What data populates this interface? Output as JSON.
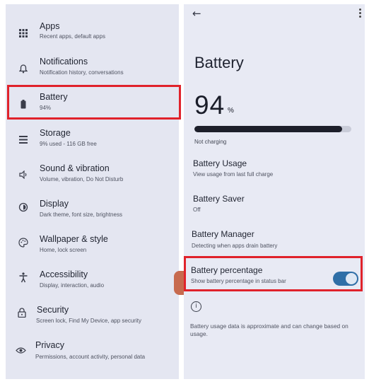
{
  "left": {
    "items": [
      {
        "icon": "apps-grid-icon",
        "glyph": "⋮⋮",
        "title": "Apps",
        "subtitle": "Recent apps, default apps"
      },
      {
        "icon": "bell-icon",
        "glyph": "🔔︎",
        "title": "Notifications",
        "subtitle": "Notification history, conversations"
      },
      {
        "icon": "battery-icon",
        "glyph": "▮",
        "title": "Battery",
        "subtitle": "94%"
      },
      {
        "icon": "storage-icon",
        "glyph": "☰",
        "title": "Storage",
        "subtitle": "9% used - 116 GB free"
      },
      {
        "icon": "speaker-icon",
        "glyph": "🔈︎",
        "title": "Sound & vibration",
        "subtitle": "Volume, vibration, Do Not Disturb"
      },
      {
        "icon": "display-icon",
        "glyph": "☼",
        "title": "Display",
        "subtitle": "Dark theme, font size, brightness"
      },
      {
        "icon": "palette-icon",
        "glyph": "🎨︎",
        "title": "Wallpaper & style",
        "subtitle": "Home, lock screen"
      },
      {
        "icon": "accessibility-icon",
        "glyph": "♿︎",
        "title": "Accessibility",
        "subtitle": "Display, interaction, audio"
      },
      {
        "icon": "lock-icon",
        "glyph": "🔒︎",
        "title": "Security",
        "subtitle": "Screen lock, Find My Device, app security"
      },
      {
        "icon": "privacy-eye-icon",
        "glyph": "◉",
        "title": "Privacy",
        "subtitle": "Permissions, account activity, personal data"
      }
    ]
  },
  "right": {
    "title": "Battery",
    "percent_value": "94",
    "percent_unit": "%",
    "level": 0.94,
    "charging_status": "Not charging",
    "options": [
      {
        "title": "Battery Usage",
        "subtitle": "View usage from last full charge"
      },
      {
        "title": "Battery Saver",
        "subtitle": "Off"
      },
      {
        "title": "Battery Manager",
        "subtitle": "Detecting when apps drain battery"
      },
      {
        "title": "Battery percentage",
        "subtitle": "Show battery percentage in status bar",
        "toggle_on": true
      }
    ],
    "footnote": "Battery usage data is approximate and can change based on usage."
  },
  "colors": {
    "highlight": "#e0222b",
    "toggle_on": "#2f6fa7"
  }
}
